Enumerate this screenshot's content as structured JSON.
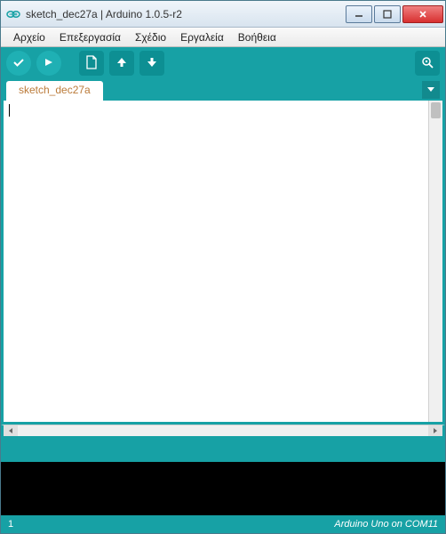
{
  "window": {
    "title": "sketch_dec27a | Arduino 1.0.5-r2"
  },
  "menu": {
    "file": "Αρχείο",
    "edit": "Επεξεργασία",
    "sketch": "Σχέδιο",
    "tools": "Εργαλεία",
    "help": "Βοήθεια"
  },
  "toolbar_icons": {
    "verify": "check-icon",
    "upload": "arrow-right-icon",
    "new": "file-icon",
    "open": "arrow-up-icon",
    "save": "arrow-down-icon",
    "serial": "serial-monitor-icon"
  },
  "tabs": {
    "active": "sketch_dec27a"
  },
  "editor": {
    "content": ""
  },
  "status": {
    "line": "1",
    "board": "Arduino Uno on COM11"
  },
  "colors": {
    "teal": "#17a1a5",
    "tab_text": "#bb7b3a"
  }
}
